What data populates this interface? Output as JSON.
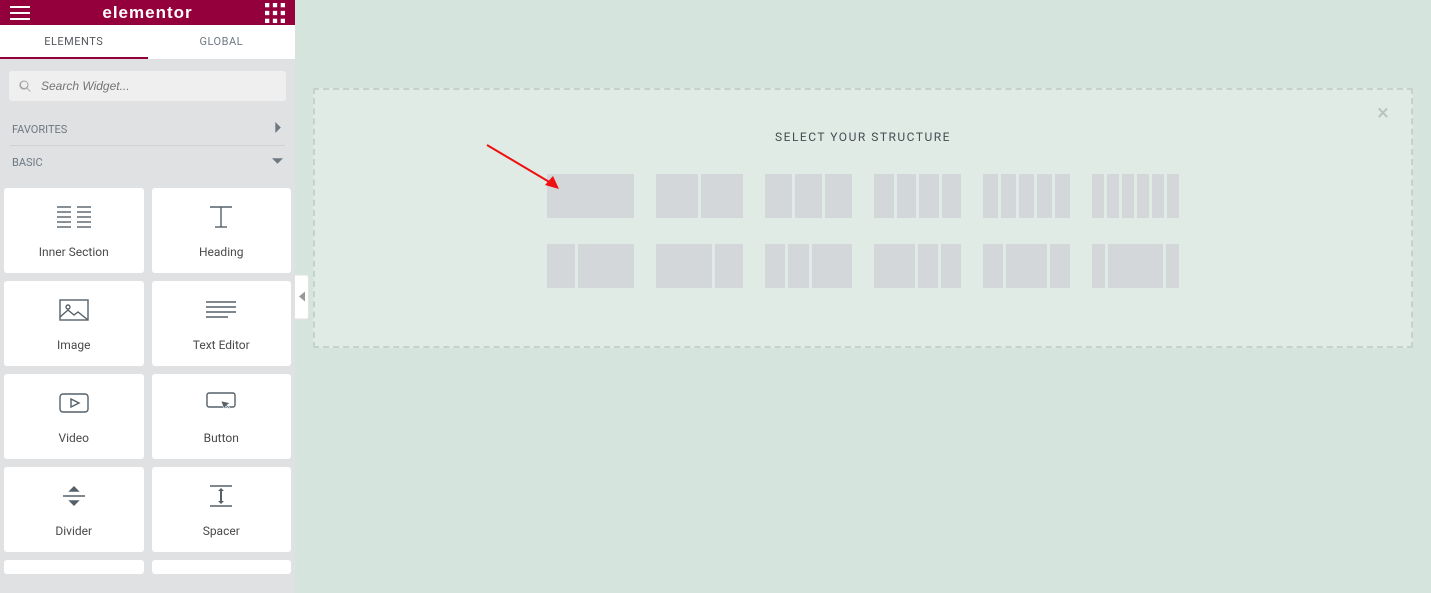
{
  "header": {
    "brand": "elementor"
  },
  "tabs": {
    "elements": "ELEMENTS",
    "global": "GLOBAL"
  },
  "search": {
    "placeholder": "Search Widget..."
  },
  "sections": {
    "favorites": "FAVORITES",
    "basic": "BASIC"
  },
  "widgets": {
    "inner_section": "Inner Section",
    "heading": "Heading",
    "image": "Image",
    "text_editor": "Text Editor",
    "video": "Video",
    "button": "Button",
    "divider": "Divider",
    "spacer": "Spacer"
  },
  "canvas": {
    "structure_title": "SELECT YOUR STRUCTURE",
    "structure_presets": [
      [
        [
          100
        ],
        [
          50,
          50
        ],
        [
          33,
          33,
          33
        ],
        [
          25,
          25,
          25,
          25
        ],
        [
          20,
          20,
          20,
          20,
          20
        ],
        [
          16,
          16,
          16,
          16,
          16,
          16
        ]
      ],
      [
        [
          33,
          66
        ],
        [
          66,
          33
        ],
        [
          25,
          25,
          50
        ],
        [
          50,
          25,
          25
        ],
        [
          25,
          50,
          25
        ],
        [
          16,
          66,
          16
        ]
      ]
    ]
  }
}
